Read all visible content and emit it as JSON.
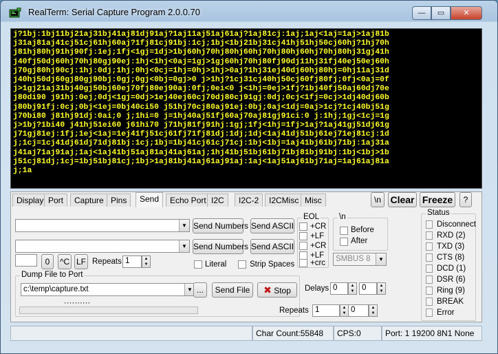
{
  "window": {
    "title": "RealTerm: Serial Capture Program 2.0.0.70",
    "min_glyph": "—",
    "max_glyph": "▭",
    "close_glyph": "✕"
  },
  "terminal": {
    "lines": [
      "j?1bj:1bj11bj21aj31bj41aj81dj91aj?1aj11aj51aj61aj?1aj81cj:1aj;1aj<1aj=1aj>1aj81b",
      "j31aj81aj41cj51cj61hj60aj?1fj81cj91bj:1cj;1bj<1bj21bj31cj41hj51hj50cj60hj?1hj70h",
      "j81hj80hj91hj90fj:1ej;1fj<1gj=1dj>1bj60hj70hj80hj60hj70hj80hj60hj70hj80hj31gj41h",
      "j40fj50dj60hj70hj80gj90ej:1hj<1hj<0aj=1gj>1gj60hj70hj80fj90dj11hj31fj40ej50ej60h",
      "j70gj80hj90cj:1hj:0dj;1hj;0hj<0cj=1hj=0hj>1hj>0aj?1hj31ej40dj60hj80hj=0hj11aj31d",
      "j40hj50dj60gj80gj90bj:0gj;0gj<0bj=0gj>0 j>1hj?1cj31cj40hj50cj60fj80fj;0fj<0aj=0f",
      "j>1gj21aj31bj40gj50bj60ej70fj80ej90aj:0fj;0ei<0 j<1hj=0ej>1fj?1bj40fj50aj60dj70e",
      "j80di90 j91hj:0ej;0dj<1gj=0dj>1ej40ej60cj70dj80cj91gj:0dj;0cj<1fj=0cj>1dj40dj60b",
      "j80bj91fj:0cj;0bj<1ej=0bj40ci50 j51hj70cj80aj91ej:0bj;0aj<1dj=0aj>1cj?1cj40bj51g",
      "j70bi80 j81hj91dj:0ai;0 j;1hi=0 j=1hj40aj51fj60aj70aj81gj91ci:0 j:1hj;1gj<1cj=1g",
      "j>1bj?1bi40 j41hj51ei60 j61hi70 j71hj81fj91hj:1gj;1fj<1hj=1fj>1aj?1aj41gj51dj61g",
      "j71gj81ej:1fj;1ej<1aj=1ej41fj51cj61fj71fj81dj:1dj;1dj<1aj41dj51bj61ej71ej81cj:1d",
      "j;1cj=1cj41dj61dj71dj81bj:1cj;1bj=1bj41cj61cj71cj:1bj<1bj=1aj41bj61bj71bj:1aj31a",
      "j41aj71aj91aj;1aj<1aj41bj51aj81aj41aj61aj;1hj41bj51bj61bj71bj81bj91bj:1bj<1bj>1b",
      "j51cj81dj;1cj=1bj51bj81cj;1bj>1aj81bj41aj61aj91aj:1aj<1aj51aj61bj71aj=1aj61aj81a",
      "j;1a"
    ]
  },
  "tabs": [
    {
      "label": "Display"
    },
    {
      "label": "Port"
    },
    {
      "label": "Capture"
    },
    {
      "label": "Pins"
    },
    {
      "label": "Send"
    },
    {
      "label": "Echo Port"
    },
    {
      "label": "I2C"
    },
    {
      "label": "I2C-2"
    },
    {
      "label": "I2CMisc"
    },
    {
      "label": "Misc"
    }
  ],
  "toolbar": {
    "newline_label": "\\n",
    "clear_label": "Clear",
    "freeze_label": "Freeze",
    "help_label": "?"
  },
  "send": {
    "send_numbers_1": "Send Numbers",
    "send_ascii_1": "Send ASCII",
    "send_numbers_2": "Send Numbers",
    "send_ascii_2": "Send ASCII",
    "repeat_value": "",
    "zero_button": "0",
    "ctrl_c_button": "^C",
    "lf_button": "LF",
    "repeats_label": "Repeats",
    "repeats_value": "1",
    "literal_label": "Literal",
    "strip_spaces_label": "Strip Spaces",
    "eol_label": "EOL",
    "eol_options": [
      "+CR",
      "+LF",
      "+CR",
      "+LF",
      "+crc"
    ],
    "nl_group_label": "\\n",
    "before_label": "Before",
    "after_label": "After",
    "smbus_value": "SMBUS 8"
  },
  "dump": {
    "group_label": "Dump File to Port",
    "file_path": "c:\\temp\\capture.txt",
    "browse_label": "...",
    "send_file_label": "Send File",
    "stop_label": "Stop",
    "delays_label": "Delays",
    "delay1": "0",
    "delay2": "0",
    "repeats_label": "Repeats",
    "repeats1": "1",
    "repeats2": "0",
    "dots": "··········"
  },
  "status": {
    "group_label": "Status",
    "items": [
      {
        "label": "Disconnect"
      },
      {
        "label": "RXD (2)"
      },
      {
        "label": "TXD (3)"
      },
      {
        "label": "CTS (8)"
      },
      {
        "label": "DCD (1)"
      },
      {
        "label": "DSR (6)"
      },
      {
        "label": "Ring (9)"
      },
      {
        "label": "BREAK"
      },
      {
        "label": "Error"
      }
    ]
  },
  "statusbar": {
    "char_count": "Char Count:55848",
    "cps": "CPS:0",
    "port": "Port: 1 19200 8N1 None"
  }
}
